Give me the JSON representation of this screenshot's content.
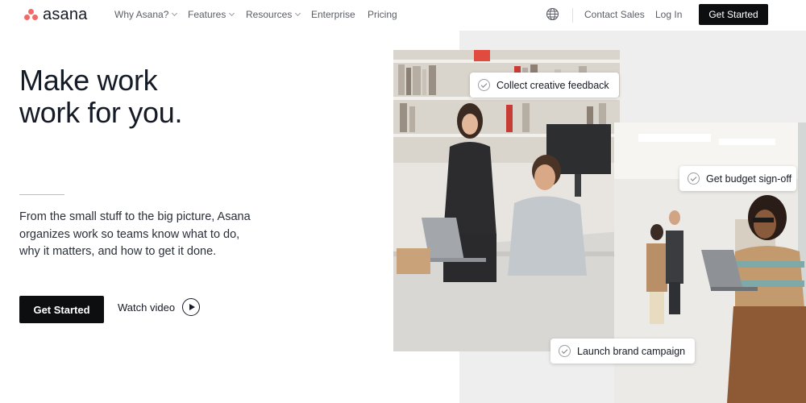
{
  "brand": {
    "name": "asana",
    "accent": "#f06a6a"
  },
  "nav": {
    "items": [
      {
        "label": "Why Asana?",
        "has_dropdown": true
      },
      {
        "label": "Features",
        "has_dropdown": true
      },
      {
        "label": "Resources",
        "has_dropdown": true
      },
      {
        "label": "Enterprise",
        "has_dropdown": false
      },
      {
        "label": "Pricing",
        "has_dropdown": false
      }
    ],
    "globe_icon": "globe-icon",
    "contact_sales": "Contact Sales",
    "login": "Log In",
    "cta": "Get Started"
  },
  "hero": {
    "title_line1": "Make work",
    "title_line2": "work for you.",
    "subtitle": "From the small stuff to the big picture, Asana organizes work so teams know what to do, why it matters, and how to get it done.",
    "cta": "Get Started",
    "watch_video": "Watch video",
    "play_icon": "play-icon"
  },
  "task_chips": [
    {
      "label": "Collect creative feedback",
      "icon": "check-circle-icon"
    },
    {
      "label": "Get budget sign-off",
      "icon": "check-circle-icon"
    },
    {
      "label": "Launch brand campaign",
      "icon": "check-circle-icon"
    }
  ],
  "colors": {
    "button_dark": "#0d0e10",
    "text_primary": "#151b26",
    "panel_gray": "#eeeeee"
  }
}
